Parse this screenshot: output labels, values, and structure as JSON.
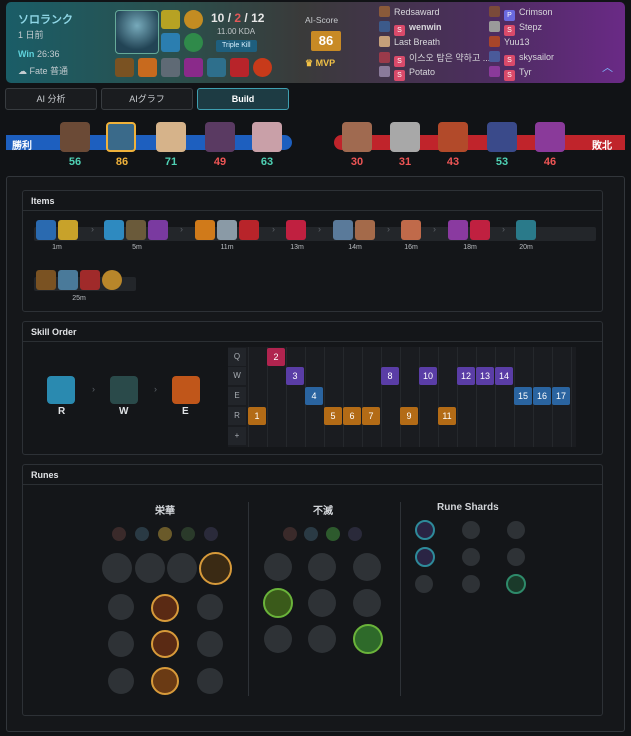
{
  "header": {
    "mode": "ソロランク",
    "ago": "1 日前",
    "result": "Win",
    "duration": "26:36",
    "fate_label": "Fate 普通",
    "kda_kills": "10",
    "kda_deaths": "2",
    "kda_assists": "12",
    "kda_ratio": "11.00 KDA",
    "badge": "Triple Kill",
    "ai_score_label": "AI-Score",
    "ai_score": "86",
    "mvp": "MVP",
    "collapse_icon": "chevron-up-icon"
  },
  "players_left": [
    {
      "name": "Redsaward",
      "badge": ""
    },
    {
      "name": "wenwin",
      "badge": "S"
    },
    {
      "name": "Last Breath",
      "badge": ""
    },
    {
      "name": "이스오 탑은 약하고 ...",
      "badge": "S"
    },
    {
      "name": "Potato",
      "badge": "S"
    }
  ],
  "players_right": [
    {
      "name": "Crimson",
      "badge": "P"
    },
    {
      "name": "Stepz",
      "badge": "S"
    },
    {
      "name": "Yuu13",
      "badge": ""
    },
    {
      "name": "skysailor",
      "badge": "S"
    },
    {
      "name": "Tyr",
      "badge": "S"
    }
  ],
  "tabs": [
    "AI 分析",
    "AIグラフ",
    "Build"
  ],
  "team_bar": {
    "win_label": "勝利",
    "lose_label": "敗北",
    "left_scores": [
      "56",
      "86",
      "71",
      "49",
      "63"
    ],
    "right_scores": [
      "30",
      "31",
      "43",
      "53",
      "46"
    ]
  },
  "items_section": {
    "title": "Items",
    "groups": [
      {
        "time": "1m"
      },
      {
        "time": "5m"
      },
      {
        "time": "11m"
      },
      {
        "time": "13m"
      },
      {
        "time": "14m"
      },
      {
        "time": "16m"
      },
      {
        "time": "18m"
      },
      {
        "time": "20m"
      },
      {
        "time": "25m"
      }
    ]
  },
  "skill_section": {
    "title": "Skill Order",
    "rows": [
      "Q",
      "W",
      "E",
      "R",
      "+"
    ],
    "max_order": [
      "R",
      "W",
      "E"
    ],
    "levels": [
      {
        "n": "1",
        "row": "R"
      },
      {
        "n": "2",
        "row": "Q"
      },
      {
        "n": "3",
        "row": "W"
      },
      {
        "n": "4",
        "row": "E"
      },
      {
        "n": "5",
        "row": "R"
      },
      {
        "n": "6",
        "row": "R"
      },
      {
        "n": "7",
        "row": "R"
      },
      {
        "n": "8",
        "row": "W"
      },
      {
        "n": "9",
        "row": "R"
      },
      {
        "n": "10",
        "row": "W"
      },
      {
        "n": "11",
        "row": "R"
      },
      {
        "n": "12",
        "row": "W"
      },
      {
        "n": "13",
        "row": "W"
      },
      {
        "n": "14",
        "row": "W"
      },
      {
        "n": "15",
        "row": "E"
      },
      {
        "n": "16",
        "row": "E"
      },
      {
        "n": "17",
        "row": "E"
      }
    ]
  },
  "runes_section": {
    "title": "Runes",
    "primary": "栄華",
    "secondary": "不滅",
    "shards": "Rune Shards"
  },
  "colors": {
    "accent": "#3f9fb0",
    "win_blue": "#1d5fbf",
    "lose_red": "#c0242b",
    "score_green": "#4fd1b4",
    "score_red": "#ef5555",
    "q": "#b0244f",
    "w": "#5a3da6",
    "e": "#2a64a0",
    "r": "#b36b16"
  }
}
